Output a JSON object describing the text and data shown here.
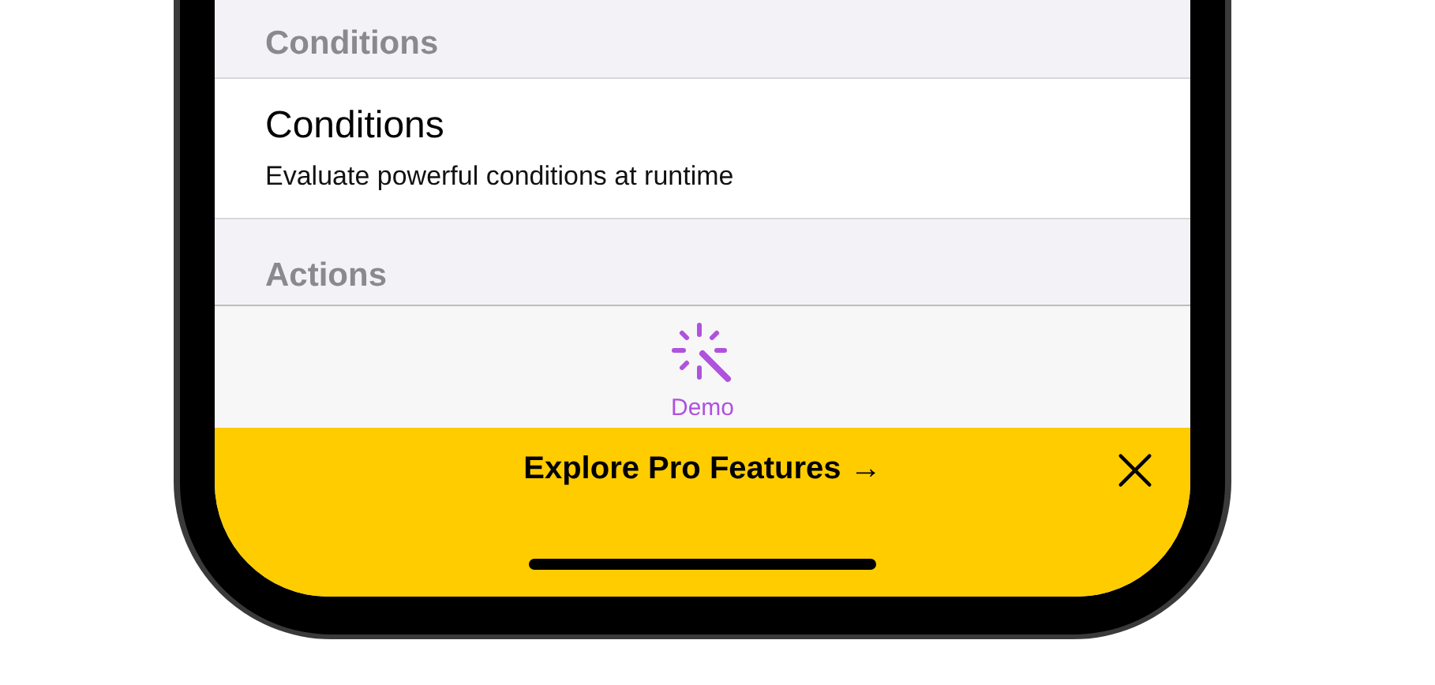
{
  "sections": [
    {
      "header": "Conditions",
      "rows": [
        {
          "title": "Conditions",
          "subtitle": "Evaluate powerful conditions at runtime"
        }
      ]
    },
    {
      "header": "Actions"
    }
  ],
  "tab_bar": {
    "tabs": [
      {
        "label": "Demo",
        "selected": true
      }
    ]
  },
  "banner": {
    "text": "Explore Pro Features →"
  }
}
